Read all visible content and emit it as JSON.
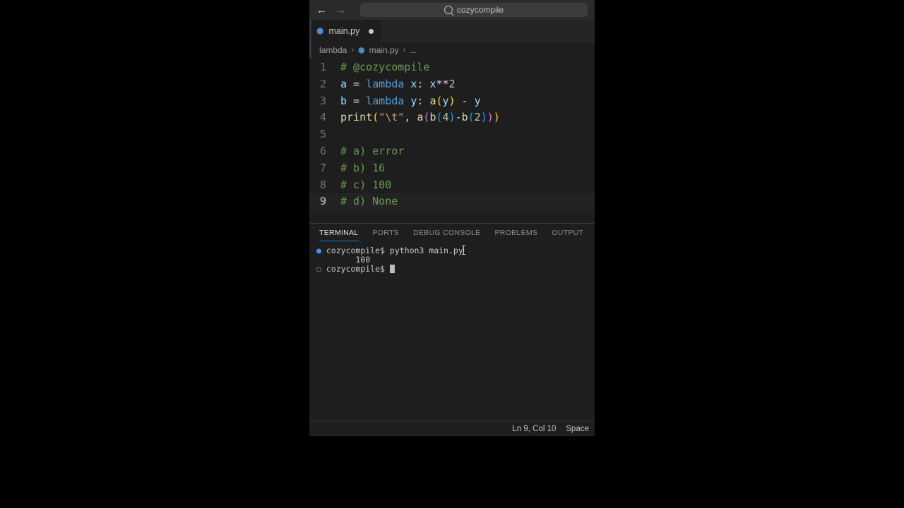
{
  "titlebar": {
    "search_text": "cozycompile"
  },
  "tab": {
    "filename": "main.py"
  },
  "breadcrumb": {
    "folder": "lambda",
    "file": "main.py",
    "tail": "..."
  },
  "code": {
    "l1": "# @cozycompile",
    "l2": {
      "v": "a",
      "eq": " = ",
      "kw": "lambda",
      "sp": " ",
      "p": "x",
      "col": ": ",
      "x": "x",
      "op": "**",
      "n": "2"
    },
    "l3": {
      "v": "b",
      "eq": " = ",
      "kw": "lambda",
      "sp": " ",
      "p": "y",
      "col": ": ",
      "f": "a",
      "lp": "(",
      "arg": "y",
      "rp": ")",
      "op": " - ",
      "y": "y"
    },
    "l4": {
      "fn": "print",
      "lp": "(",
      "s": "\"\\t\"",
      "c": ", ",
      "a": "a",
      "lp2": "(",
      "b": "b",
      "lp3": "(",
      "n4": "4",
      "rp3": ")",
      "m": "-",
      "b2": "b",
      "lp4": "(",
      "n2": "2",
      "rp4": ")",
      "rp2": ")",
      "rp": ")"
    },
    "l6": "# a) error",
    "l7": "# b) 16",
    "l8": "# c) 100",
    "l9": "# d) None",
    "lnums": [
      "1",
      "2",
      "3",
      "4",
      "5",
      "6",
      "7",
      "8",
      "9"
    ]
  },
  "panel": {
    "tabs": [
      "TERMINAL",
      "PORTS",
      "DEBUG CONSOLE",
      "PROBLEMS",
      "OUTPUT"
    ]
  },
  "terminal": {
    "prompt1": "cozycompile$ ",
    "cmd1": "python3 main.py",
    "out1": "        100",
    "prompt2": "cozycompile$ "
  },
  "status": {
    "pos": "Ln 9, Col 10",
    "spaces": "Space"
  }
}
